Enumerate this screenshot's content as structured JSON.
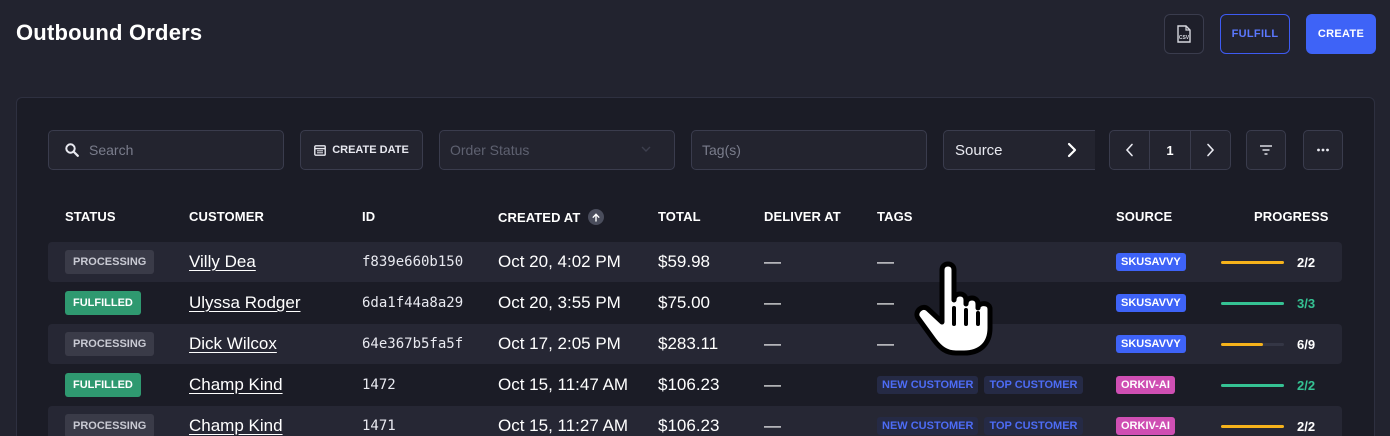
{
  "header": {
    "title": "Outbound Orders",
    "csv_icon_label": "CSV",
    "fulfill_label": "FULFILL",
    "create_label": "CREATE"
  },
  "filters": {
    "search_placeholder": "Search",
    "create_date_label": "CREATE DATE",
    "order_status_placeholder": "Order Status",
    "tags_placeholder": "Tag(s)",
    "source_label": "Source",
    "page": "1"
  },
  "columns": {
    "status": "STATUS",
    "customer": "CUSTOMER",
    "id": "ID",
    "created_at": "CREATED AT",
    "total": "TOTAL",
    "deliver_at": "DELIVER AT",
    "tags": "TAGS",
    "source": "SOURCE",
    "progress": "PROGRESS"
  },
  "rows": [
    {
      "status": "PROCESSING",
      "customer": "Villy Dea",
      "id": "f839e660b150",
      "created": "Oct 20, 4:02 PM",
      "total": "$59.98",
      "deliver": "—",
      "tags": [],
      "tags_empty": "—",
      "source": "SKUSAVVY",
      "progress_text": "2/2",
      "progress_fraction": 1.0,
      "progress_color": "#f5b21b",
      "text_color": "#ffffff"
    },
    {
      "status": "FULFILLED",
      "customer": "Ulyssa Rodger",
      "id": "6da1f44a8a29",
      "created": "Oct 20, 3:55 PM",
      "total": "$75.00",
      "deliver": "—",
      "tags": [],
      "tags_empty": "—",
      "source": "SKUSAVVY",
      "progress_text": "3/3",
      "progress_fraction": 1.0,
      "progress_color": "#35c293",
      "text_color": "#35c293"
    },
    {
      "status": "PROCESSING",
      "customer": "Dick Wilcox",
      "id": "64e367b5fa5f",
      "created": "Oct 17, 2:05 PM",
      "total": "$283.11",
      "deliver": "—",
      "tags": [],
      "tags_empty": "—",
      "source": "SKUSAVVY",
      "progress_text": "6/9",
      "progress_fraction": 0.667,
      "progress_color": "#f5b21b",
      "text_color": "#ffffff"
    },
    {
      "status": "FULFILLED",
      "customer": "Champ Kind",
      "id": "1472",
      "created": "Oct 15, 11:47 AM",
      "total": "$106.23",
      "deliver": "—",
      "tags": [
        "NEW CUSTOMER",
        "TOP CUSTOMER"
      ],
      "tags_empty": "",
      "source": "ORKIV-AI",
      "progress_text": "2/2",
      "progress_fraction": 1.0,
      "progress_color": "#35c293",
      "text_color": "#35c293"
    },
    {
      "status": "PROCESSING",
      "customer": "Champ Kind",
      "id": "1471",
      "created": "Oct 15, 11:27 AM",
      "total": "$106.23",
      "deliver": "—",
      "tags": [
        "NEW CUSTOMER",
        "TOP CUSTOMER"
      ],
      "tags_empty": "",
      "source": "ORKIV-AI",
      "progress_text": "2/2",
      "progress_fraction": 1.0,
      "progress_color": "#f5b21b",
      "text_color": "#ffffff"
    }
  ]
}
